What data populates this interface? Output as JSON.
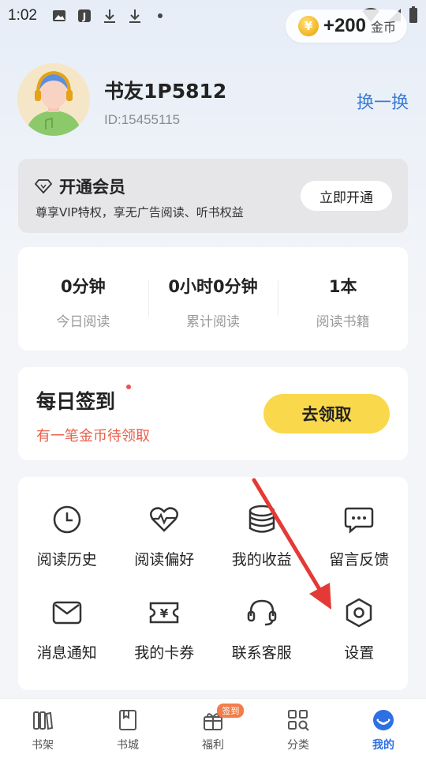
{
  "status_bar": {
    "time": "1:02"
  },
  "coins": {
    "amount": "+200",
    "unit": "金币",
    "accent": "#f2b320"
  },
  "profile": {
    "username": "书友1P5812",
    "user_id": "ID:15455115",
    "switch_label": "换一换"
  },
  "vip": {
    "title": "开通会员",
    "description": "尊享VIP特权，享无广告阅读、听书权益",
    "button": "立即开通"
  },
  "stats": [
    {
      "value": "0分钟",
      "label": "今日阅读"
    },
    {
      "value": "0小时0分钟",
      "label": "累计阅读"
    },
    {
      "value": "1本",
      "label": "阅读书籍"
    }
  ],
  "signin": {
    "title": "每日签到",
    "subtitle": "有一笔金币待领取",
    "button": "去领取",
    "subtitle_color": "#e8604c",
    "button_color": "#f9d84b"
  },
  "menu": [
    {
      "label": "阅读历史",
      "icon": "clock-icon"
    },
    {
      "label": "阅读偏好",
      "icon": "heart-pulse-icon"
    },
    {
      "label": "我的收益",
      "icon": "coins-stack-icon"
    },
    {
      "label": "留言反馈",
      "icon": "chat-bubble-icon"
    },
    {
      "label": "消息通知",
      "icon": "mail-icon"
    },
    {
      "label": "我的卡券",
      "icon": "coupon-icon"
    },
    {
      "label": "联系客服",
      "icon": "headset-icon"
    },
    {
      "label": "设置",
      "icon": "settings-hexagon-icon"
    }
  ],
  "tabs": [
    {
      "label": "书架",
      "icon": "bookshelf-icon"
    },
    {
      "label": "书城",
      "icon": "book-icon"
    },
    {
      "label": "福利",
      "icon": "gift-icon",
      "badge": "签到"
    },
    {
      "label": "分类",
      "icon": "grid-search-icon"
    },
    {
      "label": "我的",
      "icon": "profile-icon",
      "active": true
    }
  ],
  "colors": {
    "accent_blue": "#2f6fe4",
    "link_blue": "#3a7bd5",
    "annotation_arrow": "#e53935"
  }
}
